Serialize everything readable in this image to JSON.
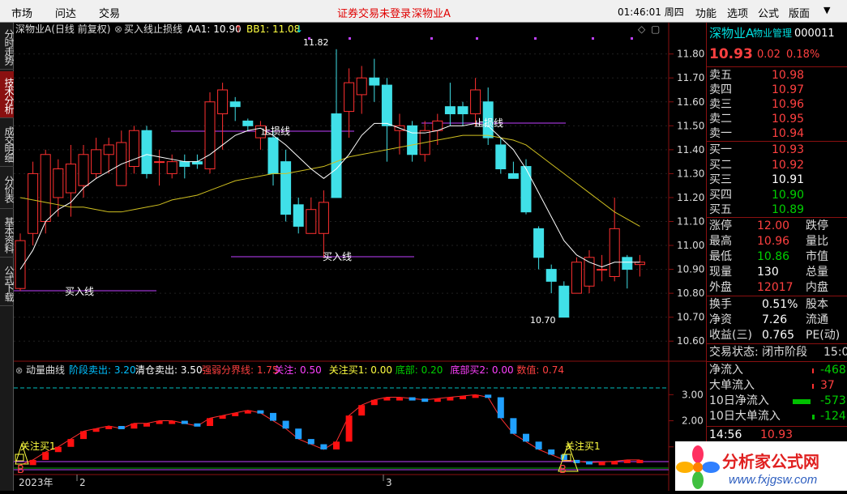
{
  "menu": {
    "items": [
      "市场",
      "问达",
      "交易"
    ],
    "alert": "证券交易未登录",
    "stock": "深物业A",
    "time": "01:46:01 周四",
    "right": [
      "功能",
      "选项",
      "公式",
      "版面"
    ]
  },
  "sidebar": [
    "分时走势",
    "技术分析",
    "成交明细",
    "分价表",
    "基本资料",
    "公式下载"
  ],
  "chart": {
    "title": "深物业A(日线 前复权)",
    "indicator": "买入线止损线",
    "aa1_label": "AA1: 10.90",
    "aa1_arrow": "↑",
    "bb1_label": "BB1: 11.08",
    "bb1_arrow": "↓",
    "y_ticks": [
      "11.80",
      "11.70",
      "11.60",
      "11.50",
      "11.40",
      "11.30",
      "11.20",
      "11.10",
      "11.00",
      "10.90",
      "10.80",
      "10.70",
      "10.60"
    ],
    "annotations": [
      "11.82",
      "10.70",
      "止损线",
      "止损线",
      "买入线",
      "买入线"
    ],
    "sub_title": "动量曲线",
    "sub_params": [
      {
        "t": "阶段卖出: 3.20",
        "c": "#00c0ff"
      },
      {
        "t": "清仓卖出: 3.50",
        "c": "#ffffff"
      },
      {
        "t": "强弱分界线: 1.75",
        "c": "#ff4040"
      },
      {
        "t": "关注: 0.50",
        "c": "#ff40ff"
      },
      {
        "t": "关注买1: 0.00",
        "c": "#ffff40"
      },
      {
        "t": "底部: 0.20",
        "c": "#00d000"
      },
      {
        "t": "底部买2: 0.00",
        "c": "#ff40ff"
      },
      {
        "t": "数值: 0.74",
        "c": "#ff4040"
      }
    ],
    "sub_ticks": [
      "3.00",
      "2.00",
      "1.00"
    ],
    "sub_labels": [
      "关注买1",
      "关注买1",
      "B",
      "B"
    ],
    "x_labels": [
      "2023年",
      "2",
      "3"
    ]
  },
  "chart_data": {
    "type": "candlestick",
    "ylim": [
      10.55,
      11.87
    ],
    "candles": [
      [
        10.82,
        11.02,
        11.05,
        10.81
      ],
      [
        11.05,
        11.3,
        11.35,
        11.0
      ],
      [
        11.1,
        11.38,
        11.4,
        11.05
      ],
      [
        11.2,
        11.32,
        11.36,
        11.12
      ],
      [
        11.22,
        11.34,
        11.42,
        11.12
      ],
      [
        11.25,
        11.38,
        11.42,
        11.2
      ],
      [
        11.3,
        11.4,
        11.45,
        11.28
      ],
      [
        11.38,
        11.42,
        11.45,
        11.3
      ],
      [
        11.25,
        11.43,
        11.48,
        11.25
      ],
      [
        11.33,
        11.48,
        11.5,
        11.3
      ],
      [
        11.48,
        11.3,
        11.5,
        11.28
      ],
      [
        11.35,
        11.35,
        11.4,
        11.25
      ],
      [
        11.3,
        11.35,
        11.38,
        11.28
      ],
      [
        11.35,
        11.33,
        11.38,
        11.28
      ],
      [
        11.35,
        11.34,
        11.38,
        11.32
      ],
      [
        11.32,
        11.6,
        11.64,
        11.3
      ],
      [
        11.55,
        11.65,
        11.68,
        11.4
      ],
      [
        11.6,
        11.58,
        11.62,
        11.52
      ],
      [
        11.52,
        11.5,
        11.53,
        11.48
      ],
      [
        11.45,
        11.5,
        11.52,
        11.4
      ],
      [
        11.45,
        11.3,
        11.48,
        11.25
      ],
      [
        11.35,
        11.13,
        11.4,
        11.1
      ],
      [
        11.17,
        11.08,
        11.2,
        11.05
      ],
      [
        11.05,
        11.15,
        11.2,
        11.05
      ],
      [
        11.05,
        11.18,
        11.23,
        10.95
      ],
      [
        11.55,
        11.2,
        11.82,
        11.2
      ],
      [
        11.56,
        11.68,
        11.74,
        11.45
      ],
      [
        11.63,
        11.7,
        11.75,
        11.55
      ],
      [
        11.7,
        11.67,
        11.78,
        11.6
      ],
      [
        11.67,
        11.5,
        11.7,
        11.35
      ],
      [
        11.48,
        11.5,
        11.55,
        11.38
      ],
      [
        11.5,
        11.38,
        11.52,
        11.35
      ],
      [
        11.38,
        11.48,
        11.52,
        11.35
      ],
      [
        11.48,
        11.52,
        11.55,
        11.42
      ],
      [
        11.58,
        11.55,
        11.68,
        11.5
      ],
      [
        11.58,
        11.55,
        11.6,
        11.5
      ],
      [
        11.55,
        11.65,
        11.7,
        11.5
      ],
      [
        11.6,
        11.45,
        11.66,
        11.42
      ],
      [
        11.42,
        11.32,
        11.45,
        11.3
      ],
      [
        11.3,
        11.28,
        11.35,
        11.28
      ],
      [
        11.33,
        11.14,
        11.36,
        11.13
      ],
      [
        11.07,
        10.95,
        11.08,
        10.9
      ],
      [
        10.9,
        10.85,
        10.92,
        10.8
      ],
      [
        10.83,
        10.7,
        10.85,
        10.7
      ],
      [
        10.8,
        10.93,
        10.95,
        10.8
      ],
      [
        10.83,
        10.95,
        10.98,
        10.8
      ],
      [
        10.9,
        10.9,
        10.96,
        10.85
      ],
      [
        10.87,
        11.07,
        11.2,
        10.85
      ],
      [
        10.95,
        10.9,
        10.96,
        10.82
      ],
      [
        10.92,
        10.93,
        10.96,
        10.87
      ]
    ],
    "ma_white": [
      10.9,
      10.98,
      11.1,
      11.15,
      11.18,
      11.24,
      11.28,
      11.31,
      11.34,
      11.36,
      11.38,
      11.37,
      11.36,
      11.35,
      11.35,
      11.38,
      11.42,
      11.46,
      11.48,
      11.49,
      11.46,
      11.42,
      11.37,
      11.32,
      11.28,
      11.32,
      11.38,
      11.46,
      11.51,
      11.51,
      11.49,
      11.47,
      11.47,
      11.48,
      11.5,
      11.5,
      11.51,
      11.5,
      11.45,
      11.4,
      11.32,
      11.22,
      11.12,
      11.02,
      10.96,
      10.93,
      10.91,
      10.93,
      10.93,
      10.93
    ],
    "ma_yellow": [
      11.2,
      11.19,
      11.18,
      11.17,
      11.16,
      11.16,
      11.15,
      11.14,
      11.14,
      11.15,
      11.16,
      11.17,
      11.19,
      11.2,
      11.21,
      11.23,
      11.25,
      11.27,
      11.28,
      11.29,
      11.3,
      11.3,
      11.31,
      11.32,
      11.33,
      11.35,
      11.37,
      11.38,
      11.39,
      11.4,
      11.41,
      11.42,
      11.43,
      11.44,
      11.45,
      11.46,
      11.46,
      11.46,
      11.45,
      11.44,
      11.42,
      11.38,
      11.34,
      11.3,
      11.26,
      11.22,
      11.18,
      11.14,
      11.11,
      11.08
    ],
    "momentum": [
      0.3,
      0.5,
      0.8,
      1.0,
      1.3,
      1.6,
      1.7,
      1.8,
      1.7,
      1.9,
      1.9,
      2.0,
      2.0,
      1.9,
      1.8,
      2.1,
      2.2,
      2.3,
      2.4,
      2.3,
      2.0,
      1.7,
      1.3,
      1.1,
      0.9,
      1.2,
      2.2,
      2.6,
      2.8,
      2.9,
      2.9,
      2.85,
      2.8,
      2.85,
      2.9,
      2.95,
      3.0,
      2.9,
      2.1,
      1.5,
      1.2,
      0.9,
      0.7,
      0.5,
      0.45,
      0.4,
      0.42,
      0.45,
      0.5,
      0.5
    ],
    "sub_ylim": [
      0,
      3.6
    ]
  },
  "right_panel": {
    "stock_name": "深物业A",
    "industry": "物业管理",
    "code": "000011",
    "price": "10.93",
    "change": "0.02",
    "pct": "0.18%",
    "asks": [
      {
        "l": "卖五",
        "p": "10.98"
      },
      {
        "l": "卖四",
        "p": "10.97"
      },
      {
        "l": "卖三",
        "p": "10.96"
      },
      {
        "l": "卖二",
        "p": "10.95"
      },
      {
        "l": "卖一",
        "p": "10.94"
      }
    ],
    "bids": [
      {
        "l": "买一",
        "p": "10.93",
        "c": "red"
      },
      {
        "l": "买二",
        "p": "10.92",
        "c": "red"
      },
      {
        "l": "买三",
        "p": "10.91",
        "c": "white"
      },
      {
        "l": "买四",
        "p": "10.90",
        "c": "green"
      },
      {
        "l": "买五",
        "p": "10.89",
        "c": "green"
      }
    ],
    "stats": [
      {
        "l": "涨停",
        "v": "12.00",
        "c": "red",
        "r": "跌停"
      },
      {
        "l": "最高",
        "v": "10.96",
        "c": "red",
        "r": "量比"
      },
      {
        "l": "最低",
        "v": "10.86",
        "c": "green",
        "r": "市值"
      },
      {
        "l": "现量",
        "v": "130",
        "c": "white",
        "r": "总量"
      },
      {
        "l": "外盘",
        "v": "12017",
        "c": "red",
        "r": "内盘"
      }
    ],
    "stats2": [
      {
        "l": "换手",
        "v": "0.51%",
        "r": "股本"
      },
      {
        "l": "净资",
        "v": "7.26",
        "r": "流通"
      },
      {
        "l": "收益(三)",
        "v": "0.765",
        "r": "PE(动)"
      }
    ],
    "trade_state": "交易状态: 闭市阶段",
    "trade_time": "15:0",
    "flows": [
      {
        "l": "净流入",
        "v": "-468",
        "c": "green"
      },
      {
        "l": "大单流入",
        "v": "37",
        "c": "red"
      },
      {
        "l": "10日净流入",
        "v": "-573",
        "c": "green"
      },
      {
        "l": "10日大单流入",
        "v": "-124",
        "c": "green"
      }
    ],
    "tick_time": "14:56",
    "tick_price": "10.93",
    "logo_text": "分析家公式网",
    "logo_url": "www.fxjgsw.com"
  }
}
